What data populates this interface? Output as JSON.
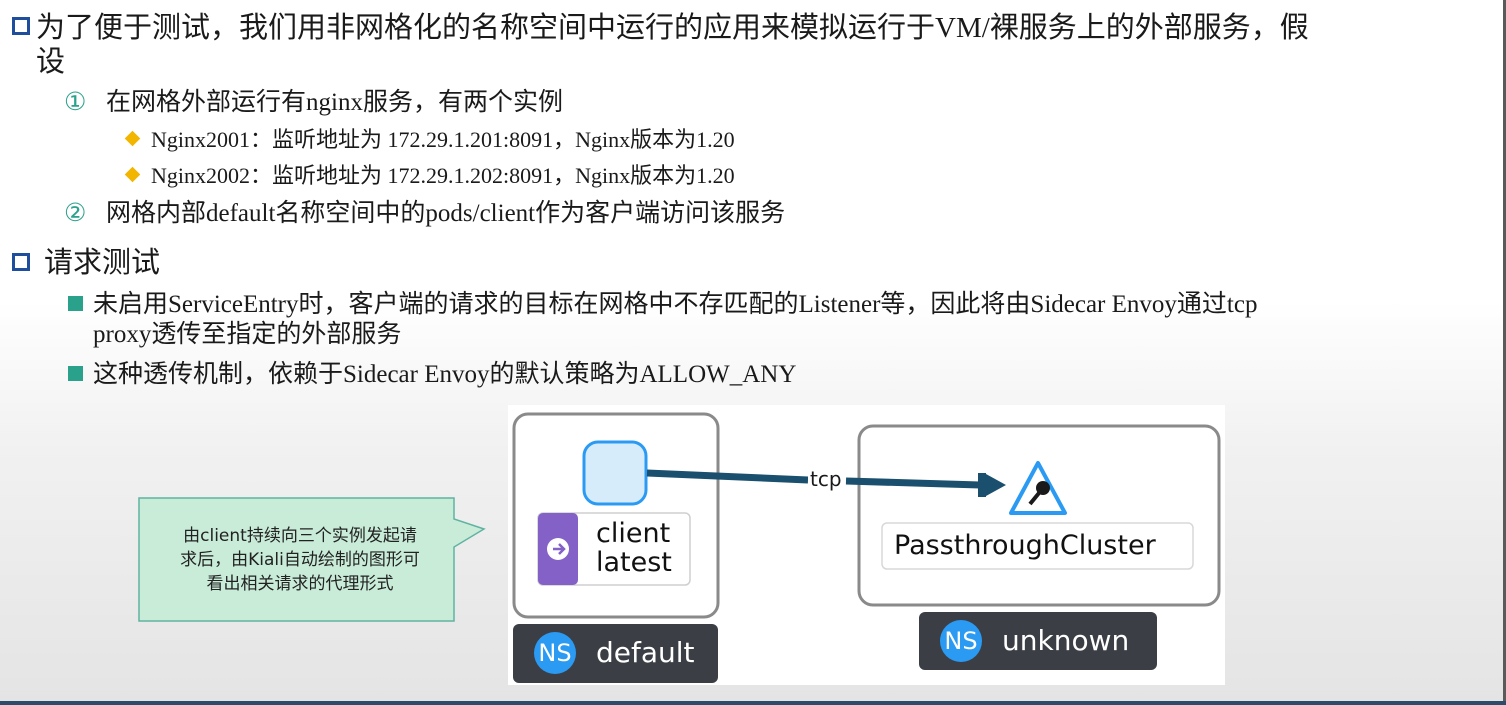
{
  "bullets": {
    "intro_line1": "为了便于测试，我们用非网格化的名称空间中运行的应用来模拟运行于VM/裸服务上的外部服务，假",
    "intro_line2": "设",
    "item1": {
      "num": "①",
      "text": "在网格外部运行有nginx服务，有两个实例"
    },
    "nginx1": "Nginx2001：监听地址为 172.29.1.201:8091，Nginx版本为1.20",
    "nginx2": "Nginx2002：监听地址为 172.29.1.202:8091，Nginx版本为1.20",
    "item2": {
      "num": "②",
      "text": "网格内部default名称空间中的pods/client作为客户端访问该服务"
    },
    "section2": "请求测试",
    "sub1_line1": "未启用ServiceEntry时，客户端的请求的目标在网格中不存匹配的Listener等，因此将由Sidecar Envoy通过tcp",
    "sub1_line2": "proxy透传至指定的外部服务",
    "sub2": "这种透传机制，依赖于Sidecar Envoy的默认策略为ALLOW_ANY"
  },
  "callout": {
    "line1": "由client持续向三个实例发起请",
    "line2": "求后，由Kiali自动绘制的图形可",
    "line3": "看出相关请求的代理形式"
  },
  "graph": {
    "client_name": "client",
    "client_version": "latest",
    "edge_label": "tcp",
    "target_name": "PassthroughCluster",
    "ns_badge": "NS",
    "ns_left": "default",
    "ns_right": "unknown"
  },
  "colors": {
    "primary_blue": "#1f4e9c",
    "teal": "#2aa18b",
    "diamond": "#f2b500",
    "edge": "#1a4f6e",
    "ns_chip": "#3b3f45",
    "ns_circle": "#2b9af3",
    "workload_purple": "#8461c7",
    "node_fill": "#d7ecfb",
    "callout_fill": "#c9ecd9"
  }
}
